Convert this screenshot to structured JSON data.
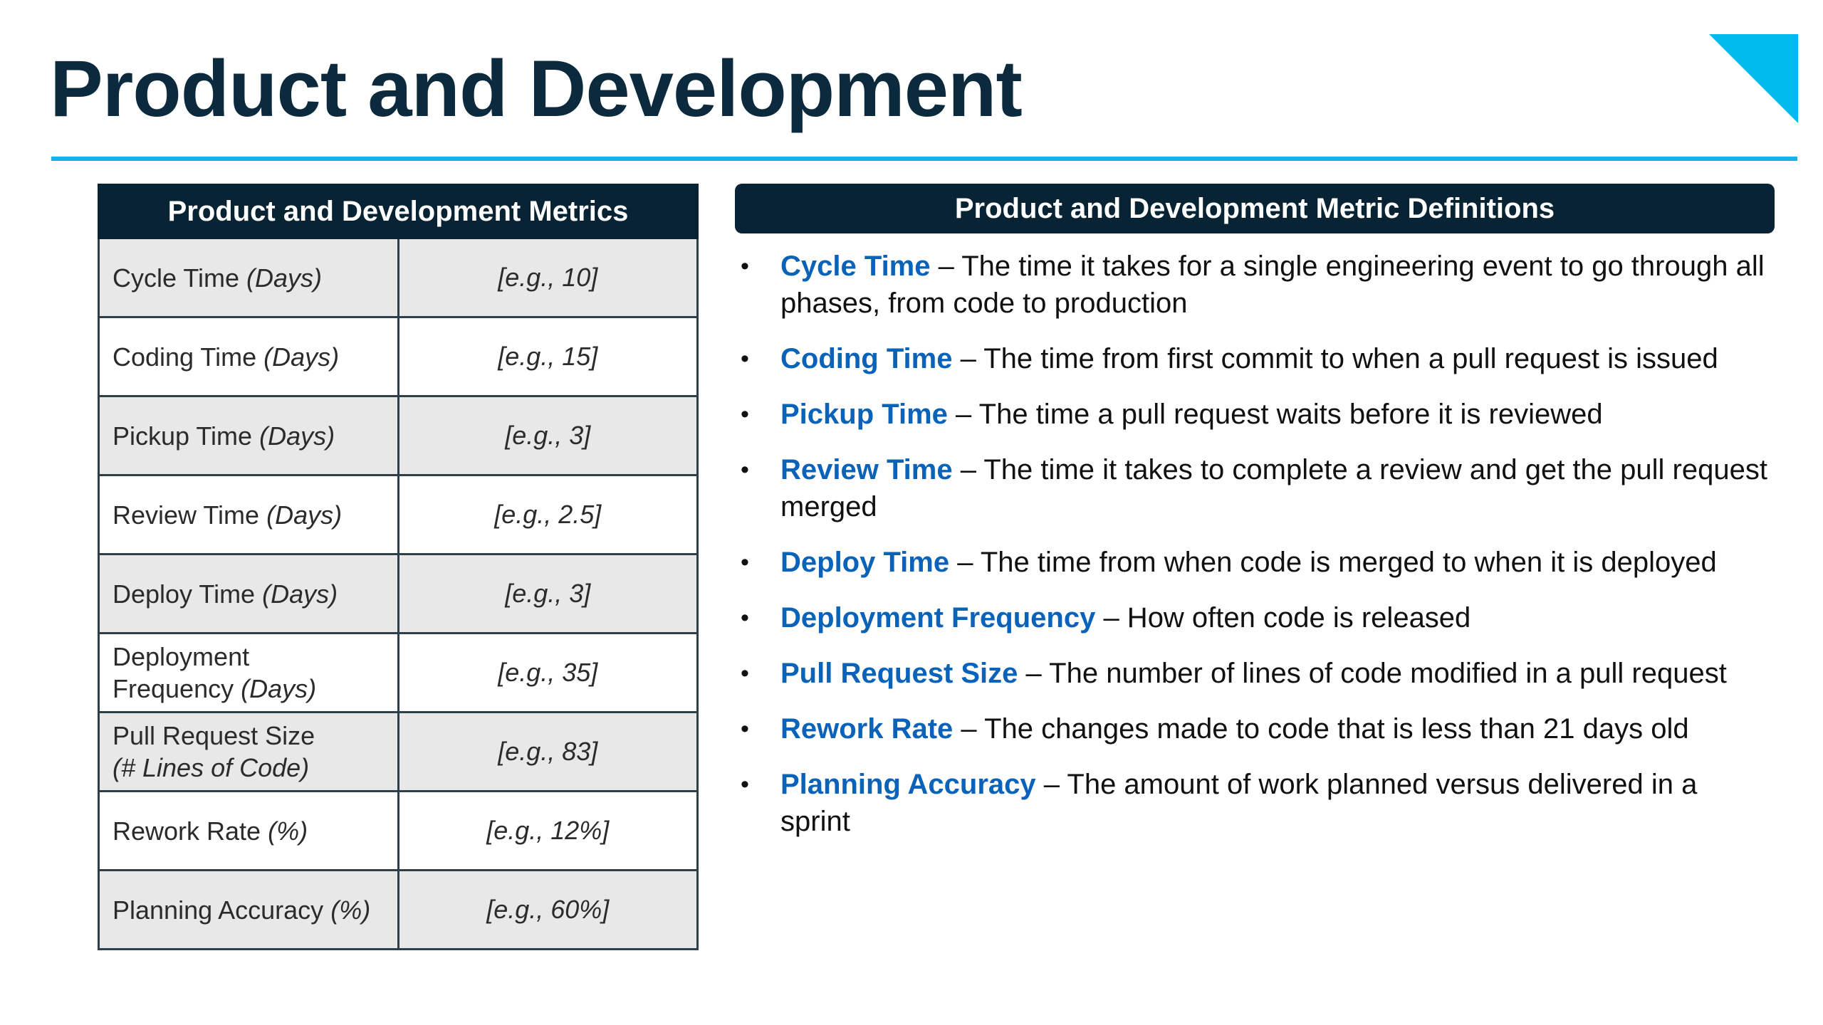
{
  "slide": {
    "title": "Product and Development",
    "accent_color": "#14b4e6",
    "dark_color": "#082434",
    "term_color": "#0a63b8"
  },
  "metrics_table": {
    "header": "Product and Development Metrics",
    "rows": [
      {
        "name": "Cycle Time",
        "unit": "(Days)",
        "value": "[e.g., 10]"
      },
      {
        "name": "Coding Time",
        "unit": "(Days)",
        "value": "[e.g., 15]"
      },
      {
        "name": "Pickup Time",
        "unit": "(Days)",
        "value": "[e.g., 3]"
      },
      {
        "name": "Review Time",
        "unit": "(Days)",
        "value": "[e.g., 2.5]"
      },
      {
        "name": "Deploy Time",
        "unit": "(Days)",
        "value": "[e.g., 3]"
      },
      {
        "name": "Deployment",
        "name_line2": "Frequency",
        "unit": "(Days)",
        "value": "[e.g., 35]"
      },
      {
        "name": "Pull Request Size",
        "unit": "(# Lines of Code)",
        "value": "[e.g., 83]"
      },
      {
        "name": "Rework Rate",
        "unit": "(%)",
        "value": "[e.g., 12%]"
      },
      {
        "name": "Planning Accuracy",
        "unit": "(%)",
        "value": "[e.g., 60%]"
      }
    ]
  },
  "definitions": {
    "header": "Product and Development Metric Definitions",
    "bullet": "•",
    "items": [
      {
        "term": "Cycle Time",
        "text": " – The time it takes for a single engineering event to go through all phases, from code to production"
      },
      {
        "term": "Coding Time",
        "text": " – The time from first commit to when a pull request is issued"
      },
      {
        "term": "Pickup Time",
        "text": " – The time a pull request waits before it is reviewed"
      },
      {
        "term": "Review Time",
        "text": " – The time it takes to complete a review and get the pull request merged"
      },
      {
        "term": "Deploy Time",
        "text": " – The time from when code is merged to when it is deployed"
      },
      {
        "term": "Deployment Frequency",
        "text": " – How often code is released"
      },
      {
        "term": "Pull Request Size",
        "text": " – The number of lines of code modified in a pull request"
      },
      {
        "term": "Rework Rate",
        "text": " – The changes made to code that is less than 21 days old"
      },
      {
        "term": "Planning Accuracy",
        "text": " – The amount of work planned versus delivered in a sprint"
      }
    ]
  }
}
